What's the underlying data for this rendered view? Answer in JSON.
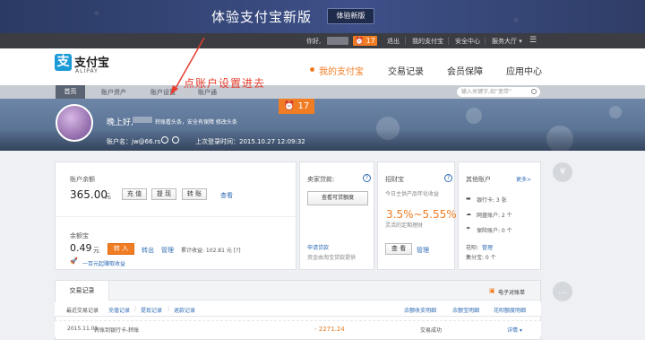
{
  "promo": {
    "title": "体验支付宝新版",
    "button": "体验新版"
  },
  "topbar": {
    "greeting": "你好,",
    "badge": "17",
    "logout": "退出",
    "my_alipay": "我的支付宝",
    "security": "安全中心",
    "service": "服务大厅 ▾"
  },
  "logo": {
    "text": "支付宝",
    "sub": "ALIPAY",
    "icon": "支"
  },
  "nav": {
    "my": "我的支付宝",
    "records": "交易记录",
    "member": "会员保障",
    "apps": "应用中心"
  },
  "annotation": "点账户设置进去",
  "subnav": {
    "home": "首页",
    "assets": "账户资产",
    "settings": "账户设置",
    "pass": "账户通",
    "search_placeholder": "输入关键字,如“宽带”"
  },
  "banner": {
    "greeting": "晚上好,",
    "tip": "转账看头条，安全有保障 修改头条",
    "account": "账户名：jw@66.rs",
    "last_login": "上次登录时间：2015.10.27 12:09:32",
    "clock_badge": "17"
  },
  "balance": {
    "label": "账户余额",
    "value": "365.00",
    "unit": "元",
    "recharge": "充 值",
    "withdraw": "提 现",
    "transfer": "转 账",
    "view": "查看"
  },
  "yuebao": {
    "label": "余额宝",
    "value": "0.49",
    "unit": "元",
    "transfer_in": "转 入",
    "transfer_out": "转出",
    "manage": "管理",
    "cumulative": "累计收益: 102.81 元 [?]",
    "promo": "一百元起赚取收益"
  },
  "loan": {
    "title": "卖家贷款:",
    "button": "查看可贷额度",
    "apply": "申请贷款",
    "desc": "资金由淘宝贷款提供"
  },
  "zhaocai": {
    "title": "招财宝",
    "desc": "今日主供产品年化收益",
    "rate": "3.5%~5.55%",
    "sub": "灵活的定期理财",
    "view": "查 看",
    "manage": "管理"
  },
  "other": {
    "title": "其他账户",
    "more": "更多>",
    "bank": "银行卡: 3 张",
    "coupon": "网盘账户: 2 个",
    "insurance": "保险账户: 0 个",
    "huabei": "花呗:",
    "huabei_link": "管理",
    "jifen": "集分宝: 0 个"
  },
  "records": {
    "tab": "交易记录",
    "bill": "电子对账单",
    "recent": "最近交易记录",
    "f1": "充值记录",
    "f2": "提现记录",
    "f3": "退款记录",
    "l1": "余额收支明细",
    "l2": "余额宝明细",
    "l3": "花呗额度明细"
  },
  "row": {
    "date": "2015.11.01",
    "desc": "转账到银行卡-转账",
    "amount": "- 2271.24",
    "status": "交易成功",
    "action": "详情 ▾"
  },
  "colors": {
    "accent": "#f07c23",
    "link": "#2f6db5",
    "brand": "#1a9ad7"
  }
}
